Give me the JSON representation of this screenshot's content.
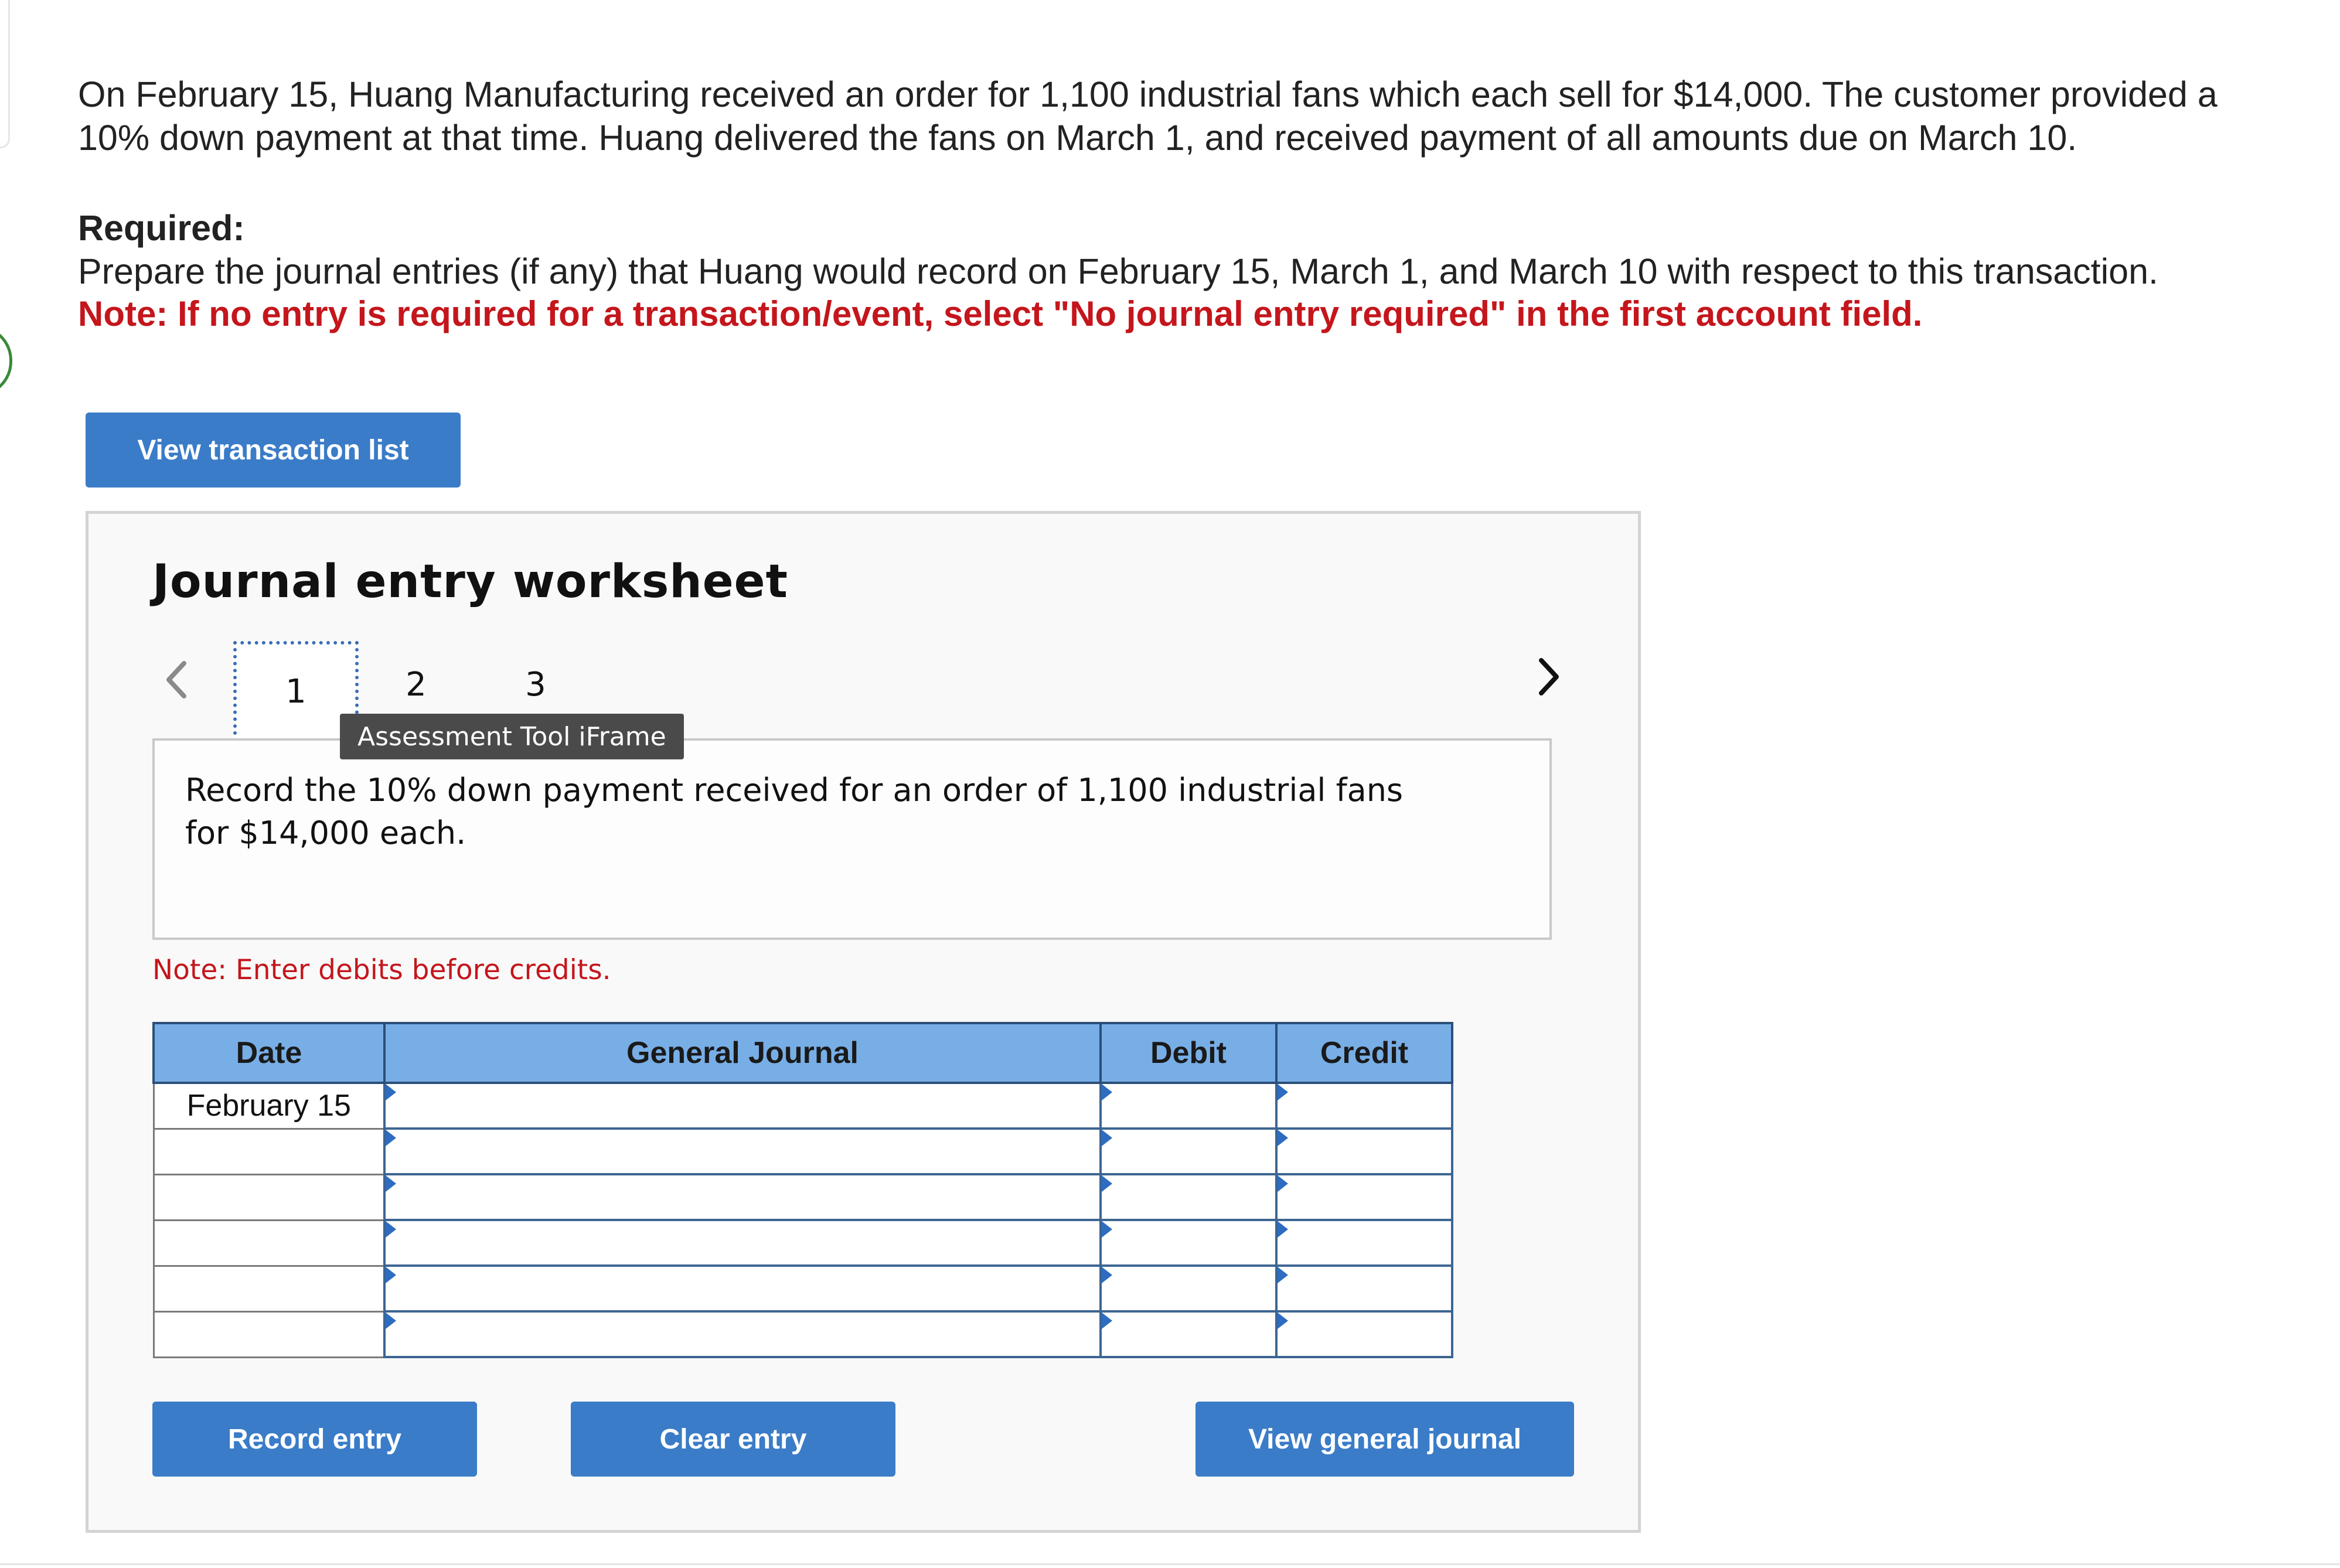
{
  "question": {
    "text": "On February 15, Huang Manufacturing received an order for 1,100 industrial fans which each sell for $14,000. The customer provided a 10% down payment at that time. Huang delivered the fans on March 1, and received payment of all amounts due on March 10."
  },
  "required": {
    "label": "Required:",
    "text": "Prepare the journal entries (if any) that Huang would record on February 15, March 1, and March 10 with respect to this transaction.",
    "note": "Note: If no entry is required for a transaction/event, select \"No journal entry required\" in the first account field."
  },
  "buttons": {
    "view_transaction_list": "View transaction list",
    "record_entry": "Record entry",
    "clear_entry": "Clear entry",
    "view_general_journal": "View general journal"
  },
  "worksheet": {
    "title": "Journal entry worksheet",
    "tabs": [
      "1",
      "2",
      "3"
    ],
    "active_tab": "1",
    "tooltip": "Assessment Tool iFrame",
    "instruction": "Record the 10% down payment received for an order of 1,100 industrial fans for $14,000 each.",
    "entry_note": "Note: Enter debits before credits."
  },
  "journal": {
    "headers": {
      "date": "Date",
      "account": "General Journal",
      "debit": "Debit",
      "credit": "Credit"
    },
    "rows": [
      {
        "date": "February 15",
        "account": "",
        "debit": "",
        "credit": ""
      },
      {
        "date": "",
        "account": "",
        "debit": "",
        "credit": ""
      },
      {
        "date": "",
        "account": "",
        "debit": "",
        "credit": ""
      },
      {
        "date": "",
        "account": "",
        "debit": "",
        "credit": ""
      },
      {
        "date": "",
        "account": "",
        "debit": "",
        "credit": ""
      },
      {
        "date": "",
        "account": "",
        "debit": "",
        "credit": ""
      }
    ]
  },
  "icons": {
    "prev": "chevron-left-icon",
    "next": "chevron-right-icon"
  },
  "colors": {
    "button": "#3a7cc7",
    "header": "#78aee6",
    "note_red": "#c4161c"
  }
}
